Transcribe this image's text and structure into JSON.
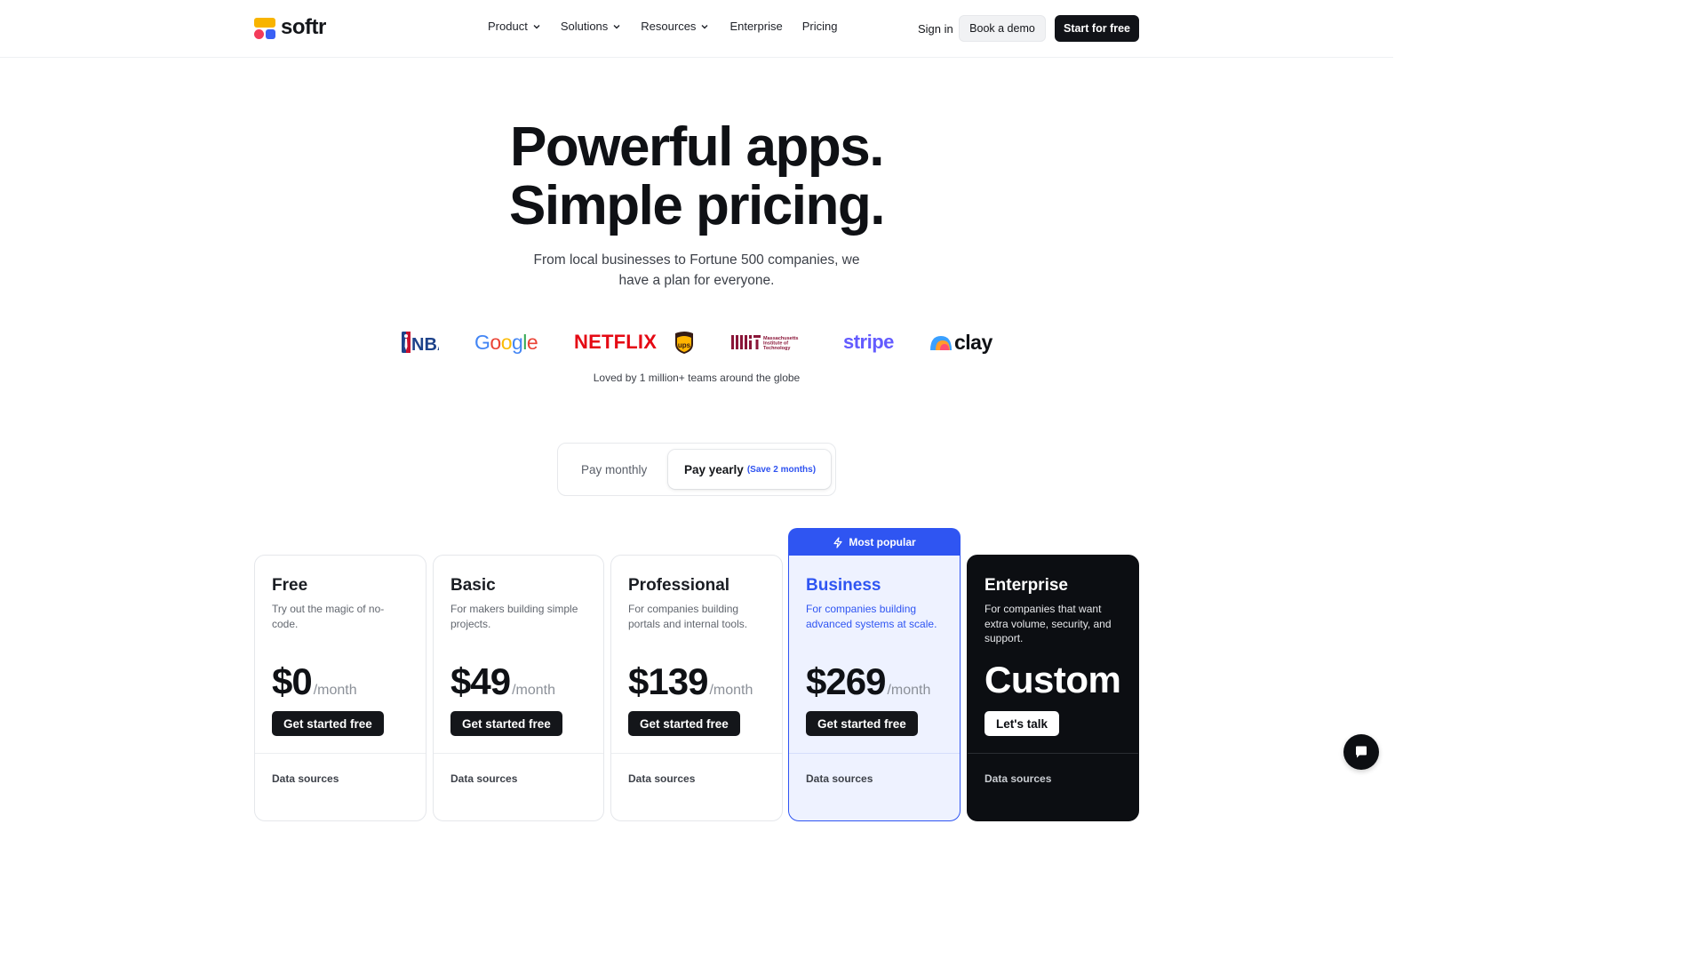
{
  "brand": {
    "name": "softr"
  },
  "nav": {
    "items": [
      {
        "label": "Product",
        "has_menu": true
      },
      {
        "label": "Solutions",
        "has_menu": true
      },
      {
        "label": "Resources",
        "has_menu": true
      },
      {
        "label": "Enterprise",
        "has_menu": false
      },
      {
        "label": "Pricing",
        "has_menu": false
      }
    ]
  },
  "header": {
    "signin": "Sign in",
    "demo": "Book a demo",
    "start": "Start for free"
  },
  "hero": {
    "line1": "Powerful apps.",
    "line2": "Simple pricing.",
    "subtitle": "From local businesses to Fortune 500 companies, we have a plan for everyone."
  },
  "logos": {
    "google": "Google",
    "netflix": "NETFLIX",
    "stripe": "stripe",
    "clay": "clay",
    "nba": "NBA",
    "mit": "Massachusetts Institute of Technology",
    "ups": "ups",
    "tagline": "Loved by 1 million+ teams around the globe"
  },
  "billing": {
    "monthly": "Pay monthly",
    "yearly": "Pay yearly",
    "yearly_note": "(Save 2 months)",
    "selected": "yearly"
  },
  "popular_badge": "Most popular",
  "plans": [
    {
      "name": "Free",
      "description": "Try out the magic of no-code.",
      "price": "$0",
      "period": "/month",
      "cta": "Get started free",
      "section": "Data sources"
    },
    {
      "name": "Basic",
      "description": "For makers building simple projects.",
      "price": "$49",
      "period": "/month",
      "cta": "Get started free",
      "section": "Data sources"
    },
    {
      "name": "Professional",
      "description": "For companies building portals and internal tools.",
      "price": "$139",
      "period": "/month",
      "cta": "Get started free",
      "section": "Data sources"
    },
    {
      "name": "Business",
      "description": "For companies building advanced systems at scale.",
      "price": "$269",
      "period": "/month",
      "cta": "Get started free",
      "section": "Data sources"
    },
    {
      "name": "Enterprise",
      "description": "For companies that want extra volume, security, and support.",
      "price": "Custom",
      "cta": "Let's talk",
      "section": "Data sources"
    }
  ],
  "colors": {
    "accent": "#2f55f2",
    "dark": "#0c0e12",
    "netflix": "#e50914",
    "stripe": "#635bff"
  }
}
